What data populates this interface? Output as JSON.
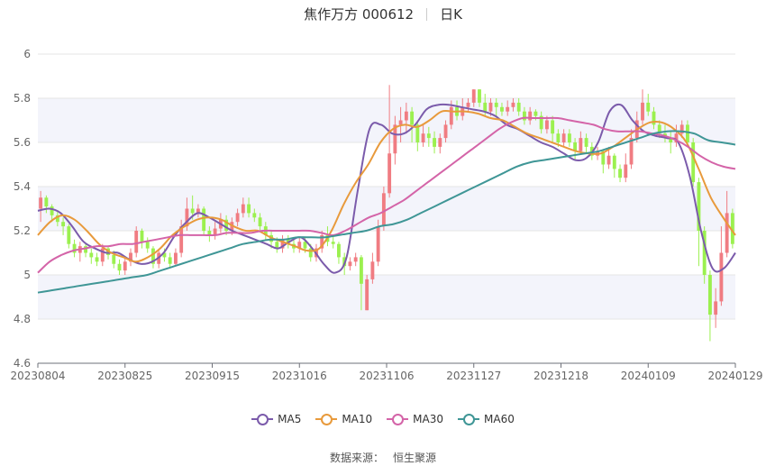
{
  "header": {
    "stock": "焦作万方 000612",
    "period": "日K"
  },
  "source": {
    "label": "数据来源：",
    "value": "恒生聚源"
  },
  "colors": {
    "up": "#f07c82",
    "down": "#9bf04f",
    "MA5": "#7b5bab",
    "MA10": "#e89a3c",
    "MA30": "#d464a8",
    "MA60": "#3f9696",
    "band": "#f3f4fb",
    "grid": "#e6e6e6"
  },
  "chart_data": {
    "type": "candlestick",
    "title": "焦作万方 000612 日K",
    "ylim": [
      4.6,
      6
    ],
    "yticks": [
      "6",
      "5.8",
      "5.6",
      "5.4",
      "5.2",
      "5",
      "4.8",
      "4.6"
    ],
    "xticks": [
      "20230804",
      "20230825",
      "20230915",
      "20231016",
      "20231106",
      "20231127",
      "20231218",
      "20240109",
      "20240129"
    ],
    "candles": [
      [
        5.3,
        5.35,
        5.24,
        5.38
      ],
      [
        5.35,
        5.31,
        5.28,
        5.36
      ],
      [
        5.31,
        5.27,
        5.24,
        5.32
      ],
      [
        5.27,
        5.24,
        5.22,
        5.29
      ],
      [
        5.24,
        5.22,
        5.18,
        5.26
      ],
      [
        5.22,
        5.14,
        5.12,
        5.23
      ],
      [
        5.14,
        5.1,
        5.08,
        5.16
      ],
      [
        5.1,
        5.13,
        5.06,
        5.15
      ],
      [
        5.13,
        5.1,
        5.08,
        5.14
      ],
      [
        5.1,
        5.08,
        5.05,
        5.12
      ],
      [
        5.08,
        5.06,
        5.04,
        5.1
      ],
      [
        5.06,
        5.12,
        5.04,
        5.14
      ],
      [
        5.12,
        5.09,
        5.07,
        5.13
      ],
      [
        5.09,
        5.05,
        5.03,
        5.11
      ],
      [
        5.05,
        5.02,
        5.0,
        5.07
      ],
      [
        5.02,
        5.06,
        5.0,
        5.08
      ],
      [
        5.06,
        5.1,
        5.04,
        5.12
      ],
      [
        5.1,
        5.2,
        5.08,
        5.22
      ],
      [
        5.2,
        5.15,
        5.12,
        5.21
      ],
      [
        5.15,
        5.12,
        5.1,
        5.17
      ],
      [
        5.12,
        5.05,
        5.03,
        5.13
      ],
      [
        5.05,
        5.1,
        5.03,
        5.11
      ],
      [
        5.1,
        5.08,
        5.06,
        5.12
      ],
      [
        5.08,
        5.05,
        5.03,
        5.1
      ],
      [
        5.05,
        5.1,
        5.04,
        5.12
      ],
      [
        5.1,
        5.22,
        5.08,
        5.25
      ],
      [
        5.22,
        5.3,
        5.2,
        5.35
      ],
      [
        5.3,
        5.28,
        5.25,
        5.36
      ],
      [
        5.28,
        5.3,
        5.26,
        5.32
      ],
      [
        5.3,
        5.2,
        5.18,
        5.31
      ],
      [
        5.2,
        5.18,
        5.15,
        5.22
      ],
      [
        5.18,
        5.21,
        5.16,
        5.24
      ],
      [
        5.21,
        5.25,
        5.19,
        5.28
      ],
      [
        5.25,
        5.2,
        5.18,
        5.27
      ],
      [
        5.2,
        5.24,
        5.18,
        5.26
      ],
      [
        5.24,
        5.28,
        5.22,
        5.3
      ],
      [
        5.28,
        5.32,
        5.26,
        5.35
      ],
      [
        5.32,
        5.28,
        5.26,
        5.35
      ],
      [
        5.28,
        5.26,
        5.24,
        5.3
      ],
      [
        5.26,
        5.22,
        5.2,
        5.28
      ],
      [
        5.22,
        5.18,
        5.16,
        5.24
      ],
      [
        5.18,
        5.15,
        5.12,
        5.2
      ],
      [
        5.15,
        5.12,
        5.1,
        5.17
      ],
      [
        5.12,
        5.16,
        5.1,
        5.18
      ],
      [
        5.16,
        5.14,
        5.12,
        5.18
      ],
      [
        5.14,
        5.12,
        5.1,
        5.16
      ],
      [
        5.12,
        5.15,
        5.1,
        5.17
      ],
      [
        5.15,
        5.12,
        5.1,
        5.17
      ],
      [
        5.12,
        5.08,
        5.06,
        5.14
      ],
      [
        5.08,
        5.12,
        5.06,
        5.14
      ],
      [
        5.12,
        5.18,
        5.1,
        5.2
      ],
      [
        5.18,
        5.15,
        5.13,
        5.22
      ],
      [
        5.15,
        5.14,
        5.12,
        5.18
      ],
      [
        5.14,
        5.08,
        5.05,
        5.15
      ],
      [
        5.08,
        5.04,
        5.0,
        5.1
      ],
      [
        5.04,
        5.06,
        5.02,
        5.08
      ],
      [
        5.06,
        5.08,
        5.04,
        5.1
      ],
      [
        5.08,
        4.96,
        4.84,
        5.09
      ],
      [
        4.84,
        4.98,
        4.84,
        5.0
      ],
      [
        4.98,
        5.06,
        4.96,
        5.1
      ],
      [
        5.06,
        5.22,
        5.04,
        5.25
      ],
      [
        5.22,
        5.37,
        5.2,
        5.4
      ],
      [
        5.37,
        5.55,
        5.35,
        5.86
      ],
      [
        5.55,
        5.68,
        5.5,
        5.72
      ],
      [
        5.68,
        5.7,
        5.6,
        5.76
      ],
      [
        5.7,
        5.74,
        5.64,
        5.78
      ],
      [
        5.74,
        5.68,
        5.6,
        5.76
      ],
      [
        5.68,
        5.6,
        5.56,
        5.7
      ],
      [
        5.6,
        5.64,
        5.58,
        5.68
      ],
      [
        5.64,
        5.62,
        5.58,
        5.67
      ],
      [
        5.62,
        5.58,
        5.55,
        5.65
      ],
      [
        5.58,
        5.62,
        5.55,
        5.64
      ],
      [
        5.62,
        5.68,
        5.6,
        5.7
      ],
      [
        5.68,
        5.76,
        5.66,
        5.79
      ],
      [
        5.76,
        5.72,
        5.7,
        5.79
      ],
      [
        5.72,
        5.76,
        5.7,
        5.8
      ],
      [
        5.76,
        5.78,
        5.74,
        5.8
      ],
      [
        5.78,
        5.84,
        5.76,
        5.84
      ],
      [
        5.84,
        5.78,
        5.76,
        5.84
      ],
      [
        5.78,
        5.74,
        5.72,
        5.82
      ],
      [
        5.74,
        5.78,
        5.72,
        5.8
      ],
      [
        5.78,
        5.76,
        5.72,
        5.8
      ],
      [
        5.76,
        5.74,
        5.72,
        5.78
      ],
      [
        5.74,
        5.76,
        5.72,
        5.79
      ],
      [
        5.76,
        5.78,
        5.74,
        5.8
      ],
      [
        5.78,
        5.74,
        5.72,
        5.8
      ],
      [
        5.74,
        5.7,
        5.68,
        5.76
      ],
      [
        5.7,
        5.74,
        5.68,
        5.76
      ],
      [
        5.74,
        5.72,
        5.7,
        5.75
      ],
      [
        5.72,
        5.66,
        5.64,
        5.74
      ],
      [
        5.66,
        5.7,
        5.64,
        5.72
      ],
      [
        5.7,
        5.64,
        5.6,
        5.72
      ],
      [
        5.64,
        5.6,
        5.58,
        5.66
      ],
      [
        5.6,
        5.64,
        5.58,
        5.66
      ],
      [
        5.64,
        5.6,
        5.58,
        5.66
      ],
      [
        5.6,
        5.56,
        5.52,
        5.62
      ],
      [
        5.56,
        5.62,
        5.55,
        5.65
      ],
      [
        5.62,
        5.58,
        5.55,
        5.64
      ],
      [
        5.58,
        5.54,
        5.52,
        5.6
      ],
      [
        5.54,
        5.56,
        5.52,
        5.58
      ],
      [
        5.56,
        5.5,
        5.46,
        5.57
      ],
      [
        5.5,
        5.54,
        5.48,
        5.58
      ],
      [
        5.54,
        5.48,
        5.44,
        5.55
      ],
      [
        5.48,
        5.44,
        5.42,
        5.5
      ],
      [
        5.44,
        5.5,
        5.42,
        5.55
      ],
      [
        5.5,
        5.62,
        5.48,
        5.66
      ],
      [
        5.62,
        5.7,
        5.6,
        5.74
      ],
      [
        5.7,
        5.78,
        5.68,
        5.84
      ],
      [
        5.78,
        5.74,
        5.72,
        5.82
      ],
      [
        5.74,
        5.68,
        5.66,
        5.76
      ],
      [
        5.68,
        5.64,
        5.62,
        5.7
      ],
      [
        5.64,
        5.62,
        5.6,
        5.68
      ],
      [
        5.62,
        5.6,
        5.55,
        5.65
      ],
      [
        5.6,
        5.64,
        5.58,
        5.68
      ],
      [
        5.64,
        5.68,
        5.62,
        5.7
      ],
      [
        5.68,
        5.6,
        5.58,
        5.7
      ],
      [
        5.6,
        5.42,
        5.4,
        5.62
      ],
      [
        5.42,
        5.2,
        5.04,
        5.44
      ],
      [
        5.2,
        5.0,
        4.96,
        5.22
      ],
      [
        5.0,
        4.82,
        4.7,
        5.02
      ],
      [
        4.82,
        4.88,
        4.76,
        4.94
      ],
      [
        4.88,
        5.1,
        4.86,
        5.22
      ],
      [
        5.1,
        5.28,
        5.08,
        5.38
      ],
      [
        5.28,
        5.14,
        5.12,
        5.3
      ]
    ],
    "series": [
      {
        "name": "MA5",
        "values": [
          5.29,
          5.3,
          5.28,
          5.22,
          5.15,
          5.12,
          5.1,
          5.1,
          5.07,
          5.05,
          5.06,
          5.1,
          5.18,
          5.24,
          5.28,
          5.26,
          5.23,
          5.2,
          5.18,
          5.16,
          5.14,
          5.12,
          5.15,
          5.17,
          5.12,
          5.05,
          5.01,
          5.08,
          5.39,
          5.66,
          5.68,
          5.64,
          5.64,
          5.68,
          5.75,
          5.77,
          5.77,
          5.76,
          5.75,
          5.74,
          5.72,
          5.68,
          5.66,
          5.63,
          5.6,
          5.58,
          5.55,
          5.52,
          5.53,
          5.6,
          5.74,
          5.77,
          5.7,
          5.65,
          5.63,
          5.62,
          5.6,
          5.45,
          5.2,
          5.03,
          5.03,
          5.1
        ]
      },
      {
        "name": "MA10",
        "values": [
          5.18,
          5.24,
          5.27,
          5.25,
          5.2,
          5.14,
          5.1,
          5.08,
          5.06,
          5.08,
          5.12,
          5.18,
          5.22,
          5.25,
          5.26,
          5.25,
          5.22,
          5.2,
          5.2,
          5.17,
          5.15,
          5.13,
          5.11,
          5.12,
          5.2,
          5.32,
          5.42,
          5.5,
          5.6,
          5.66,
          5.68,
          5.67,
          5.7,
          5.74,
          5.74,
          5.74,
          5.73,
          5.71,
          5.7,
          5.67,
          5.64,
          5.62,
          5.6,
          5.58,
          5.56,
          5.55,
          5.55,
          5.58,
          5.62,
          5.66,
          5.69,
          5.69,
          5.66,
          5.6,
          5.48,
          5.35,
          5.26,
          5.18
        ]
      },
      {
        "name": "MA30",
        "values": [
          5.01,
          5.06,
          5.09,
          5.11,
          5.12,
          5.13,
          5.13,
          5.14,
          5.14,
          5.15,
          5.16,
          5.17,
          5.18,
          5.18,
          5.18,
          5.18,
          5.19,
          5.19,
          5.19,
          5.2,
          5.2,
          5.2,
          5.2,
          5.2,
          5.19,
          5.18,
          5.2,
          5.23,
          5.26,
          5.28,
          5.31,
          5.34,
          5.38,
          5.42,
          5.46,
          5.5,
          5.54,
          5.58,
          5.62,
          5.66,
          5.69,
          5.71,
          5.71,
          5.71,
          5.71,
          5.7,
          5.69,
          5.68,
          5.66,
          5.65,
          5.65,
          5.65,
          5.64,
          5.63,
          5.61,
          5.58,
          5.54,
          5.51,
          5.49,
          5.48
        ]
      },
      {
        "name": "MA60",
        "values": [
          4.92,
          4.93,
          4.94,
          4.95,
          4.96,
          4.97,
          4.98,
          4.99,
          5.0,
          5.02,
          5.04,
          5.06,
          5.08,
          5.1,
          5.12,
          5.14,
          5.15,
          5.16,
          5.16,
          5.17,
          5.17,
          5.17,
          5.18,
          5.19,
          5.2,
          5.22,
          5.23,
          5.25,
          5.28,
          5.31,
          5.34,
          5.37,
          5.4,
          5.43,
          5.46,
          5.49,
          5.51,
          5.52,
          5.53,
          5.54,
          5.55,
          5.56,
          5.58,
          5.6,
          5.62,
          5.64,
          5.65,
          5.65,
          5.64,
          5.61,
          5.6,
          5.59
        ]
      }
    ]
  }
}
